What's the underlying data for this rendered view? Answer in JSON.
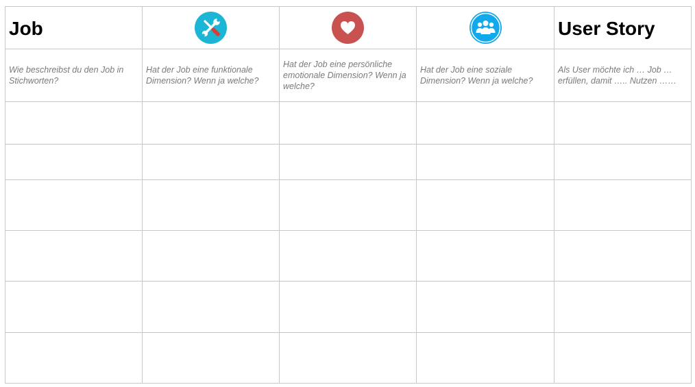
{
  "header": {
    "job_title": "Job",
    "user_story_title": "User Story",
    "icons": {
      "functional": {
        "name": "tools-icon",
        "color": "#1bb5d6"
      },
      "emotional": {
        "name": "heart-icon",
        "color": "#c9514f"
      },
      "social": {
        "name": "group-icon",
        "color": "#12a9ec"
      }
    }
  },
  "questions": {
    "job": "Wie beschreibst du den Job  in Stichworten?",
    "functional": "Hat der Job eine funktionale Dimension? Wenn ja welche?",
    "emotional": "Hat der Job eine persönliche emotionale Dimension? Wenn ja welche?",
    "social": "Hat der Job eine soziale Dimension? Wenn ja welche?",
    "user_story": "Als User möchte ich … Job … erfüllen, damit ….. Nutzen ……"
  }
}
